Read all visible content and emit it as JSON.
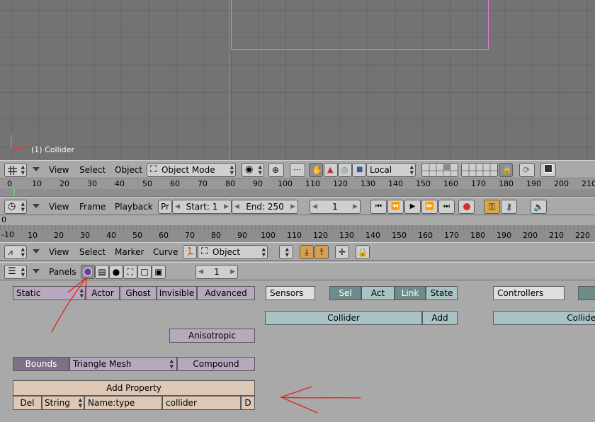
{
  "viewport": {
    "object_label": "(1) Collider",
    "axis_x": "x"
  },
  "view3d_header": {
    "menus": [
      "View",
      "Select",
      "Object"
    ],
    "mode": "Object Mode",
    "orientation": "Local"
  },
  "timeline_ruler": {
    "ticks": [
      "0",
      "10",
      "20",
      "30",
      "40",
      "50",
      "60",
      "70",
      "80",
      "90",
      "100",
      "110",
      "120",
      "130",
      "140",
      "150",
      "160",
      "170",
      "180",
      "190",
      "200",
      "210"
    ]
  },
  "timeline_header": {
    "menus": [
      "View",
      "Frame",
      "Playback"
    ],
    "pr_label": "Pr",
    "start": "Start: 1",
    "end": "End: 250",
    "current_frame": "1"
  },
  "action_ruler": {
    "top_label": "0",
    "ticks": [
      "-10",
      "10",
      "20",
      "30",
      "40",
      "50",
      "60",
      "70",
      "80",
      "90",
      "100",
      "110",
      "120",
      "130",
      "140",
      "150",
      "160",
      "170",
      "180",
      "190",
      "200",
      "210",
      "220"
    ]
  },
  "action_header": {
    "menus": [
      "View",
      "Select",
      "Marker",
      "Curve"
    ],
    "mode": "Object"
  },
  "buttons_header": {
    "panels_label": "Panels",
    "page": "1"
  },
  "physics": {
    "type": "Static",
    "toggles": [
      "Actor",
      "Ghost",
      "Invisible",
      "Advanced"
    ],
    "anisotropic": "Anisotropic",
    "bounds": "Bounds",
    "bounds_type": "Triangle Mesh",
    "compound": "Compound",
    "add_property": "Add Property",
    "property": {
      "del": "Del",
      "type": "String",
      "name": "Name:type",
      "value": "collider",
      "debug": "D"
    }
  },
  "sensors": {
    "label": "Sensors",
    "tabs": [
      "Sel",
      "Act",
      "Link",
      "State"
    ],
    "object": "Collider",
    "add": "Add"
  },
  "controllers": {
    "label": "Controllers",
    "object": "Collide"
  },
  "colors": {
    "annotation": "#e0231e",
    "selection_outline": "#e27ce2",
    "green_axis": "#5cb85c"
  }
}
